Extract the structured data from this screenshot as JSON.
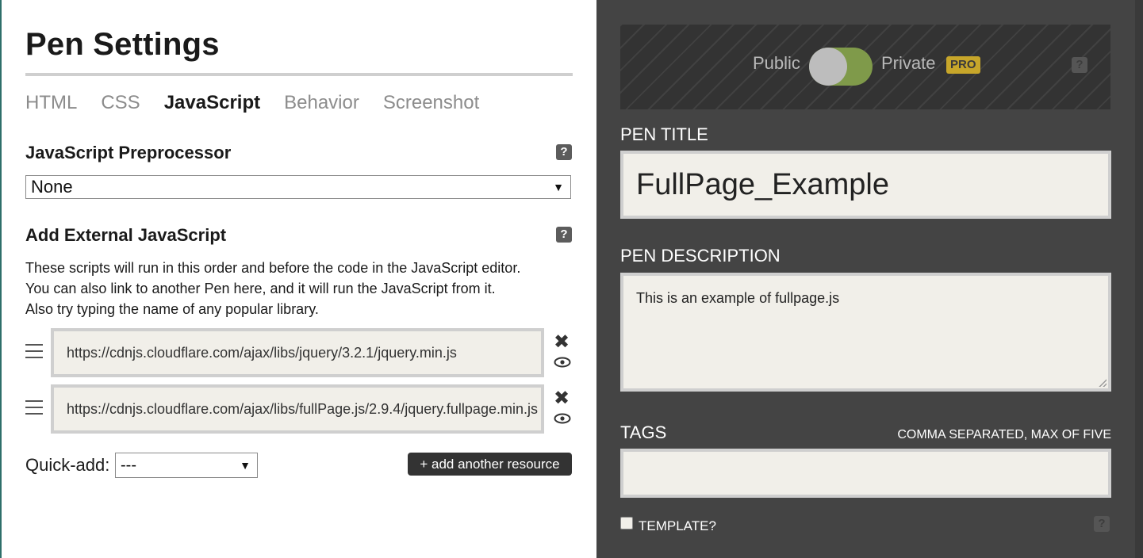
{
  "left": {
    "title": "Pen Settings",
    "tabs": [
      {
        "label": "HTML",
        "active": false
      },
      {
        "label": "CSS",
        "active": false
      },
      {
        "label": "JavaScript",
        "active": true
      },
      {
        "label": "Behavior",
        "active": false
      },
      {
        "label": "Screenshot",
        "active": false
      }
    ],
    "preprocessor": {
      "heading": "JavaScript Preprocessor",
      "help_label": "?",
      "selected": "None",
      "arrow": "▼"
    },
    "external": {
      "heading": "Add External JavaScript",
      "help_label": "?",
      "description_lines": [
        "These scripts will run in this order and before the code in the JavaScript editor.",
        "You can also link to another Pen here, and it will run the JavaScript from it.",
        "Also try typing the name of any popular library."
      ],
      "resources": [
        "https://cdnjs.cloudflare.com/ajax/libs/jquery/3.2.1/jquery.min.js",
        "https://cdnjs.cloudflare.com/ajax/libs/fullPage.js/2.9.4/jquery.fullpage.min.js"
      ],
      "remove_icon": "✖",
      "quick_add_label": "Quick-add:",
      "quick_add_selected": "---",
      "quick_add_arrow": "▼",
      "add_button": "+ add another resource"
    }
  },
  "right": {
    "privacy": {
      "public_label": "Public",
      "private_label": "Private",
      "pro_badge": "PRO",
      "help_label": "?",
      "private_enabled": true
    },
    "pen_title_label": "PEN TITLE",
    "pen_title_value": "FullPage_Example",
    "pen_description_label": "PEN DESCRIPTION",
    "pen_description_value": "This is an example of fullpage.js",
    "tags_label": "TAGS",
    "tags_hint": "COMMA SEPARATED, MAX OF FIVE",
    "tags_value": "",
    "template_label": "TEMPLATE?",
    "template_checked": false,
    "template_help_label": "?"
  },
  "colors": {
    "left_bg": "#ffffff",
    "right_bg": "#444444",
    "toggle_on": "#7f9a4a",
    "pro_badge": "#c7a62a",
    "input_bg": "#f1efe9"
  },
  "icons": [
    "question-help-icon",
    "drag-handle-icon",
    "close-icon",
    "eye-icon",
    "dropdown-arrow-icon",
    "resize-grip-icon"
  ]
}
